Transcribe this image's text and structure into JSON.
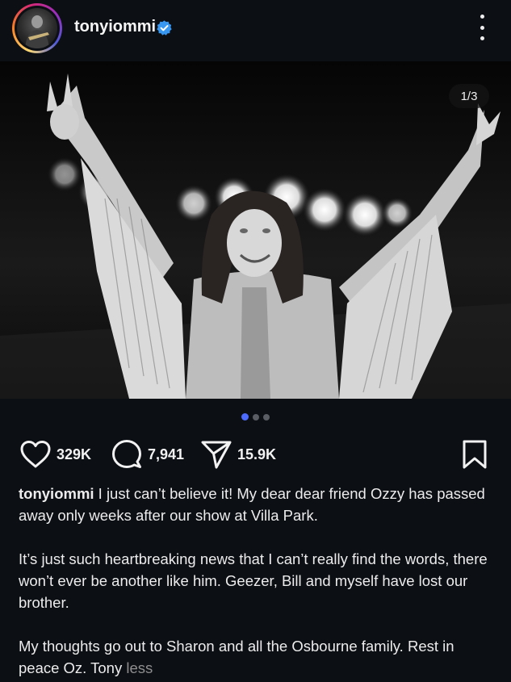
{
  "header": {
    "username": "tonyiommi",
    "verified": true,
    "avatar_icon": "profile-photo",
    "more_icon": "vertical-dots-icon"
  },
  "post": {
    "image_counter": "1/3",
    "carousel": {
      "total": 3,
      "active": 1
    }
  },
  "actions": {
    "likes": "329K",
    "comments": "7,941",
    "shares": "15.9K"
  },
  "caption": {
    "username": "tonyiommi",
    "para1": "I just can’t believe it! My dear dear friend Ozzy has passed away only weeks after our show at Villa Park.",
    "para2": "It’s just such heartbreaking news that I can’t really find the words, there won’t ever be another like him. Geezer, Bill and myself have lost our brother.",
    "para3": "My thoughts go out to Sharon and all the Osbourne family. Rest in peace Oz. Tony",
    "less": "less"
  },
  "colors": {
    "background": "#0c0f14",
    "verified_blue": "#3897f0",
    "active_dot": "#4e6bff",
    "muted_text": "#8e8e8e"
  }
}
